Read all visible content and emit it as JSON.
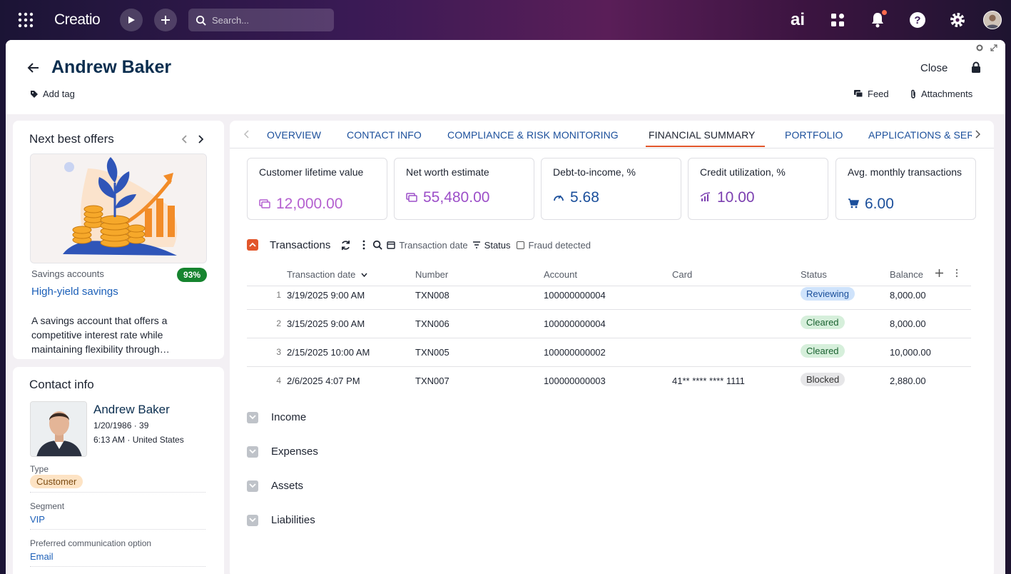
{
  "topbar": {
    "logo": "Creatio",
    "search_placeholder": "Search...",
    "ai_label": "ai"
  },
  "header": {
    "title": "Andrew Baker",
    "add_tag": "Add tag",
    "close": "Close",
    "feed": "Feed",
    "attachments": "Attachments"
  },
  "nbo": {
    "title": "Next best offers",
    "category": "Savings accounts",
    "score": "93%",
    "offer_name": "High-yield savings",
    "description": "A savings account that offers a competitive interest rate while maintaining flexibility through…"
  },
  "contact": {
    "title": "Contact info",
    "name": "Andrew Baker",
    "birth": "1/20/1986 · 39",
    "local": "6:13 AM · United States",
    "type_label": "Type",
    "type_value": "Customer",
    "segment_label": "Segment",
    "segment_value": "VIP",
    "pref_label": "Preferred communication option",
    "pref_value": "Email"
  },
  "tabs": [
    "OVERVIEW",
    "CONTACT INFO",
    "COMPLIANCE & RISK MONITORING",
    "FINANCIAL SUMMARY",
    "PORTFOLIO",
    "APPLICATIONS & SERVICES"
  ],
  "kpis": [
    {
      "title": "Customer lifetime value",
      "value": "12,000.00",
      "color": "#b45fd0"
    },
    {
      "title": "Net worth estimate",
      "value": "55,480.00",
      "color": "#9c4fc8"
    },
    {
      "title": "Debt-to-income, %",
      "value": "5.68",
      "color": "#1b4f9b"
    },
    {
      "title": "Credit utilization, %",
      "value": "10.00",
      "color": "#7b3fb0"
    },
    {
      "title": "Avg. monthly transactions",
      "value": "6.00",
      "color": "#1b4f9b"
    }
  ],
  "transactions": {
    "title": "Transactions",
    "filter_date": "Transaction date",
    "filter_status": "Status",
    "filter_fraud": "Fraud detected",
    "columns": [
      "Transaction date",
      "Number",
      "Account",
      "Card",
      "Status",
      "Balance"
    ],
    "rows": [
      {
        "n": "1",
        "date": "3/19/2025 9:00 AM",
        "number": "TXN008",
        "account": "100000000004",
        "card": "",
        "status": "Reviewing",
        "balance": "8,000.00"
      },
      {
        "n": "2",
        "date": "3/15/2025 9:00 AM",
        "number": "TXN006",
        "account": "100000000004",
        "card": "",
        "status": "Cleared",
        "balance": "8,000.00"
      },
      {
        "n": "3",
        "date": "2/15/2025 10:00 AM",
        "number": "TXN005",
        "account": "100000000002",
        "card": "",
        "status": "Cleared",
        "balance": "10,000.00"
      },
      {
        "n": "4",
        "date": "2/6/2025 4:07 PM",
        "number": "TXN007",
        "account": "100000000003",
        "card": "41** **** **** 1111",
        "status": "Blocked",
        "balance": "2,880.00"
      }
    ]
  },
  "groups": [
    "Income",
    "Expenses",
    "Assets",
    "Liabilities"
  ],
  "colors": {
    "accent": "#e2562b",
    "link": "#1b5fb8",
    "brand_text": "#0b2e4f"
  }
}
